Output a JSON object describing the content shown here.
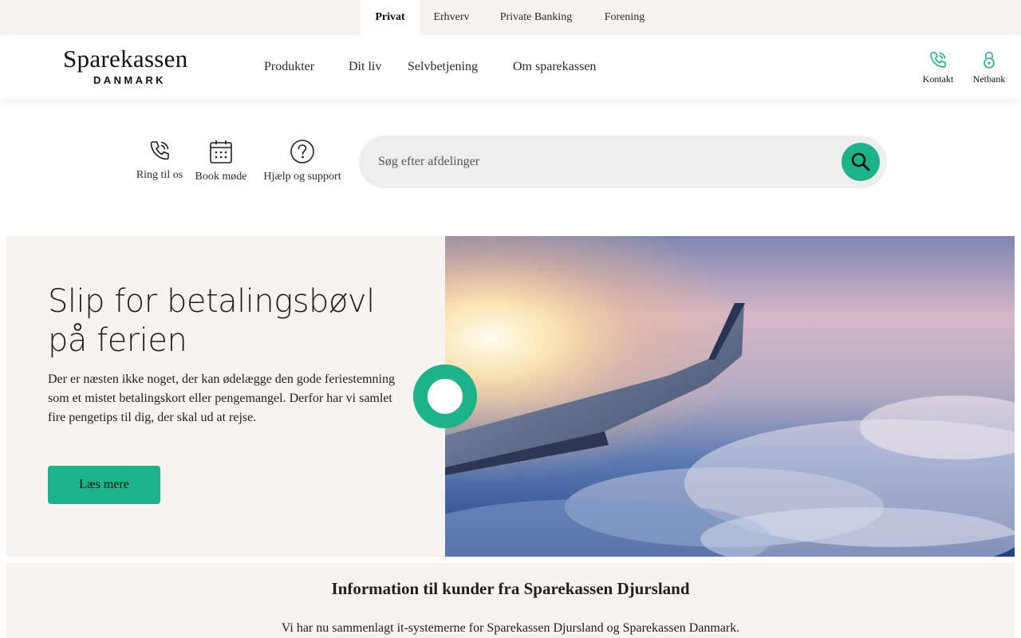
{
  "segments": [
    "Privat",
    "Erhverv",
    "Private Banking",
    "Forening"
  ],
  "logo": {
    "line1": "Sparekassen",
    "line2": "DANMARK"
  },
  "nav": [
    "Produkter",
    "Dit liv",
    "Selvbetjening",
    "Om sparekassen"
  ],
  "utility": {
    "contact": "Kontakt",
    "netbank": "Netbank"
  },
  "quick_actions": {
    "call": "Ring til os",
    "book": "Book møde",
    "help": "Hjælp og support"
  },
  "search": {
    "placeholder": "Søg efter afdelinger"
  },
  "hero": {
    "title": "Slip for betalingsbøvl på ferien",
    "text": "Der er næsten ikke noget, der kan ødelægge den gode feriestemning som et mistet betalingskort eller pengemangel. Derfor har vi samlet fire pengetips til dig, der skal ud at rejse.",
    "button": "Læs mere"
  },
  "info": {
    "title": "Information til kunder fra Sparekassen Djursland",
    "text": "Vi har nu sammenlagt it-systemerne for Sparekassen Djursland og Sparekassen Danmark."
  },
  "colors": {
    "accent": "#1db388",
    "panel": "#f6f3f0"
  }
}
